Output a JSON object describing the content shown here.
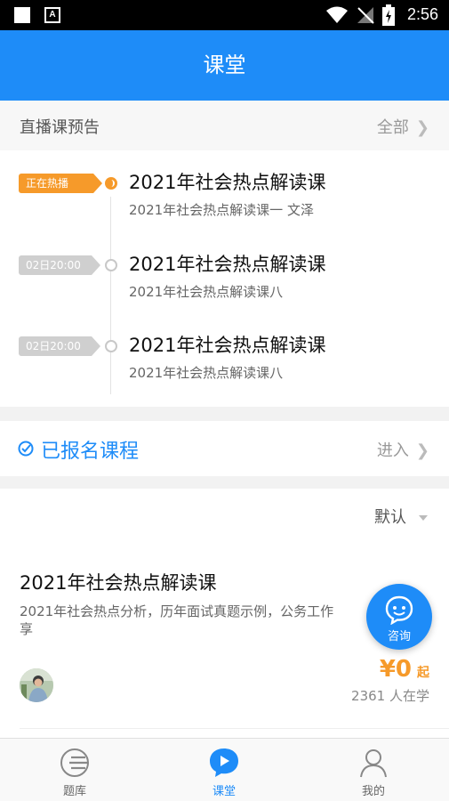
{
  "status_bar": {
    "time": "2:56"
  },
  "header": {
    "title": "课堂"
  },
  "live_section": {
    "title": "直播课预告",
    "more_label": "全部",
    "items": [
      {
        "tag": "正在热播",
        "title": "2021年社会热点解读课",
        "subtitle": "2021年社会热点解读课一 文泽"
      },
      {
        "tag": "02日20:00",
        "title": "2021年社会热点解读课",
        "subtitle": "2021年社会热点解读课八"
      },
      {
        "tag": "02日20:00",
        "title": "2021年社会热点解读课",
        "subtitle": "2021年社会热点解读课八"
      }
    ]
  },
  "enrolled": {
    "label": "已报名课程",
    "enter_label": "进入"
  },
  "course_list": {
    "sort_label": "默认",
    "courses": [
      {
        "title": "2021年社会热点解读课",
        "description": "2021年社会热点分析，历年面试真题示例，公务工作\n享",
        "price": "¥0",
        "price_suffix": "起",
        "learners": "2361 人在学"
      }
    ]
  },
  "consult_button": {
    "label": "咨询"
  },
  "tabs": [
    {
      "label": "题库",
      "icon": "question-bank-icon"
    },
    {
      "label": "课堂",
      "icon": "classroom-play-icon",
      "active": true
    },
    {
      "label": "我的",
      "icon": "profile-icon"
    }
  ],
  "colors": {
    "primary": "#1e8cf8",
    "accent_orange": "#f69a2a",
    "tag_gray": "#cfcfcf"
  }
}
